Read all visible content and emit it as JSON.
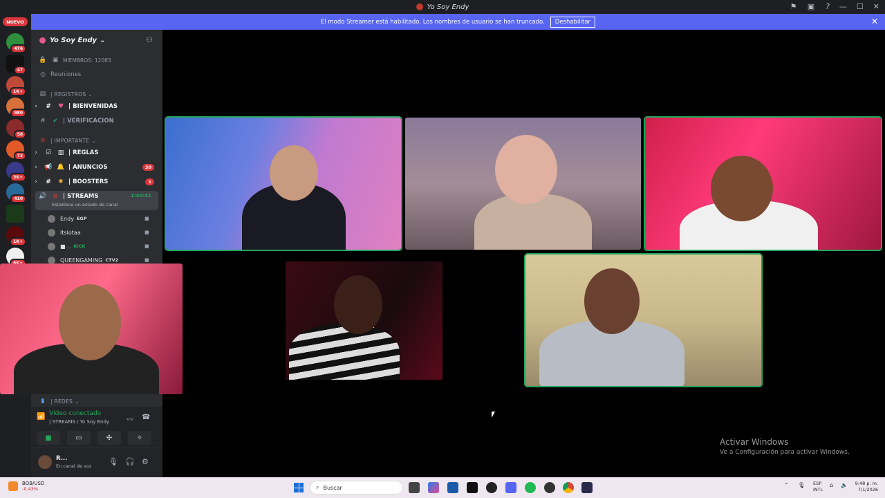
{
  "window": {
    "title": "Yo Soy Endy"
  },
  "banner": {
    "text": "El modo Streamer está habilitado. Los nombres de usuario se han truncado.",
    "button": "Deshabilitar",
    "close": "✕"
  },
  "rail": {
    "nuevo": "NUEVO",
    "servers": [
      {
        "badge": "476"
      },
      {
        "badge": "47"
      },
      {
        "badge": "1K+"
      },
      {
        "badge": "980"
      },
      {
        "badge": "58"
      },
      {
        "badge": "73"
      },
      {
        "badge": "3K+"
      },
      {
        "badge": "410"
      },
      {
        "badge": ""
      },
      {
        "badge": "1K+"
      },
      {
        "badge": "6K+"
      }
    ]
  },
  "server": {
    "name": "Yo Soy Endy"
  },
  "channels": {
    "miembros": "MIEMBROS: 12083",
    "reuniones": "Reuniones",
    "cat_registros": "| REGISTROS",
    "bienvenidas": "| BIENVENIDAS",
    "verificacion": "| VERIFICACION",
    "cat_importante": "| IMPORTANTE",
    "reglas": "| REGLAS",
    "anuncios": "| ANUNCIOS",
    "anuncios_count": "30",
    "boosters": "| BOOSTERS",
    "boosters_count": "1",
    "streams": "| STREAMS",
    "streams_timer": "1:40:41",
    "streams_sub": "Establece un estado de canal",
    "cat_redes": "| REDES"
  },
  "voice_users": [
    {
      "name": "Endy",
      "tag": "EGP"
    },
    {
      "name": "Itslotaa",
      "tag": ""
    },
    {
      "name": "■...",
      "tag": "KICK"
    },
    {
      "name": "QUEENGAMING",
      "tag": "CTV2"
    }
  ],
  "voice": {
    "status": "Vídeo conectado",
    "channel": "| STREAMS / Yo Soy Endy"
  },
  "userbar": {
    "name": "R...",
    "status": "En canal de voz"
  },
  "windows_activation": {
    "title": "Activar Windows",
    "subtitle": "Ve a Configuración para activar Windows."
  },
  "taskbar": {
    "weather_pair": "BOB/USD",
    "weather_change": "-0.43%",
    "search": "Buscar",
    "lang1": "ESP",
    "lang2": "INTL",
    "time": "9:48 p. m.",
    "date": "7/1/2026"
  },
  "colors": {
    "accent": "#5865f2",
    "speaking": "#23a55a",
    "danger": "#da373c"
  }
}
